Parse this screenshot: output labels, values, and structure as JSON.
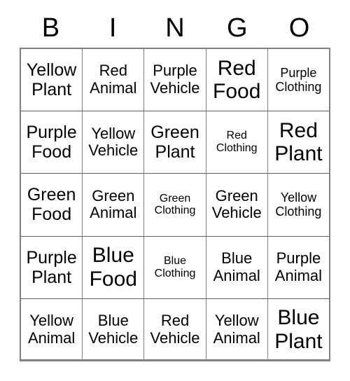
{
  "card": {
    "header": {
      "letters": [
        "B",
        "I",
        "N",
        "G",
        "O"
      ]
    },
    "rows": [
      {
        "cells": [
          {
            "line1": "Yellow",
            "line2": "Plant",
            "size": "fs-lg"
          },
          {
            "line1": "Red",
            "line2": "Animal",
            "size": "fs-md"
          },
          {
            "line1": "Purple",
            "line2": "Vehicle",
            "size": "fs-md"
          },
          {
            "line1": "Red",
            "line2": "Food",
            "size": "fs-xl"
          },
          {
            "line1": "Purple",
            "line2": "Clothing",
            "size": "fs-sm"
          }
        ]
      },
      {
        "cells": [
          {
            "line1": "Purple",
            "line2": "Food",
            "size": "fs-lg"
          },
          {
            "line1": "Yellow",
            "line2": "Vehicle",
            "size": "fs-md"
          },
          {
            "line1": "Green",
            "line2": "Plant",
            "size": "fs-lg"
          },
          {
            "line1": "Red",
            "line2": "Clothing",
            "size": "fs-xs"
          },
          {
            "line1": "Red",
            "line2": "Plant",
            "size": "fs-xl"
          }
        ]
      },
      {
        "cells": [
          {
            "line1": "Green",
            "line2": "Food",
            "size": "fs-lg"
          },
          {
            "line1": "Green",
            "line2": "Animal",
            "size": "fs-md"
          },
          {
            "line1": "Green",
            "line2": "Clothing",
            "size": "fs-xs"
          },
          {
            "line1": "Green",
            "line2": "Vehicle",
            "size": "fs-md"
          },
          {
            "line1": "Yellow",
            "line2": "Clothing",
            "size": "fs-sm"
          }
        ]
      },
      {
        "cells": [
          {
            "line1": "Purple",
            "line2": "Plant",
            "size": "fs-lg"
          },
          {
            "line1": "Blue",
            "line2": "Food",
            "size": "fs-xl"
          },
          {
            "line1": "Blue",
            "line2": "Clothing",
            "size": "fs-xs"
          },
          {
            "line1": "Blue",
            "line2": "Animal",
            "size": "fs-md"
          },
          {
            "line1": "Purple",
            "line2": "Animal",
            "size": "fs-md"
          }
        ]
      },
      {
        "cells": [
          {
            "line1": "Yellow",
            "line2": "Animal",
            "size": "fs-md"
          },
          {
            "line1": "Blue",
            "line2": "Vehicle",
            "size": "fs-md"
          },
          {
            "line1": "Red",
            "line2": "Vehicle",
            "size": "fs-md"
          },
          {
            "line1": "Yellow",
            "line2": "Animal",
            "size": "fs-md"
          },
          {
            "line1": "Blue",
            "line2": "Plant",
            "size": "fs-xl"
          }
        ]
      }
    ]
  }
}
